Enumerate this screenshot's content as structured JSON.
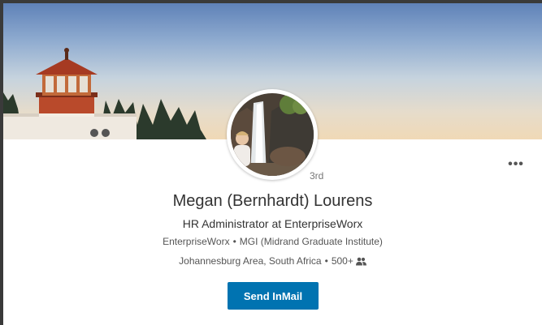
{
  "profile": {
    "name": "Megan (Bernhardt) Lourens",
    "headline": "HR Administrator at EnterpriseWorx",
    "company": "EnterpriseWorx",
    "school": "MGI (Midrand Graduate Institute)",
    "location": "Johannesburg Area, South Africa",
    "connections": "500+",
    "degree": "3rd",
    "separator": "•"
  },
  "actions": {
    "more_label": "•••",
    "inmail_label": "Send InMail"
  },
  "icons": {
    "more": "more-dots-icon",
    "connections": "people-icon"
  },
  "colors": {
    "primary_button": "#0073b1",
    "text": "#333333",
    "muted": "#555555"
  }
}
